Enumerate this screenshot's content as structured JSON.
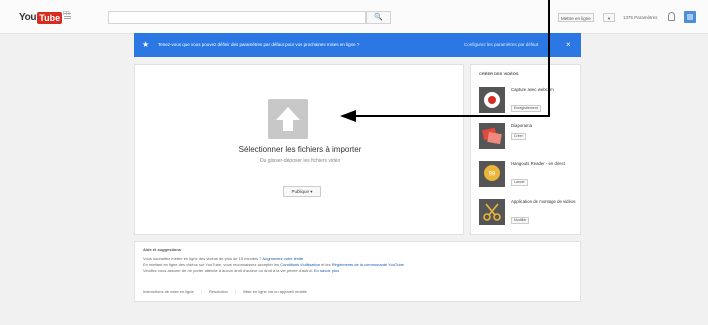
{
  "header": {
    "logo_you": "You",
    "logo_tube": "Tube",
    "logo_sup": "FR",
    "search_placeholder": "",
    "search_button": "🔍",
    "upload_menu": "Mettre en ligne",
    "upload_menu_arrow": "▾",
    "notifications": "1375 Paramètres"
  },
  "banner": {
    "message": "Tenez-vous que vous pouvez définir des paramètres par défaut pour vos prochaines mises en ligne ?",
    "link": "Configurez les paramètres par défaut",
    "close": "×"
  },
  "upload": {
    "title": "Sélectionner les fichiers à importer",
    "subtitle": "Ou glisser-déposer les fichiers vidéo",
    "privacy": "Publique ▾"
  },
  "sidebar": {
    "title": "Créer des vidéos",
    "items": [
      {
        "name": "Capture avec webcam",
        "button": "Enregistrement"
      },
      {
        "name": "Diaporama",
        "button": "Créer"
      },
      {
        "name": "Hangouts Reader - en direct",
        "button": "Lancer"
      },
      {
        "name": "Application de montage de vidéos",
        "button": "Modifier"
      }
    ]
  },
  "about": {
    "title": "Aide et suggestions",
    "line1": "Vous souhaitez mettre en ligne des vidéos de plus de 15 minutes ?",
    "line1_link": "Augmentez votre limite",
    "line2": "En mettant en ligne des vidéos sur YouTube, vous reconnaissez accepter les",
    "line2_link1": "Conditions d'utilisation",
    "line2_mid": "et les",
    "line2_link2": "Règlements de la communauté YouTube",
    "line3": "Veuillez vous assurer de ne porter atteinte à aucun droit d'auteur ou droit à la vie privée d'autrui.",
    "line3_link": "En savoir plus",
    "footer_links": [
      "Instructions de mise en ligne",
      "Résolution",
      "Mise en ligne via un appareil mobile"
    ]
  }
}
